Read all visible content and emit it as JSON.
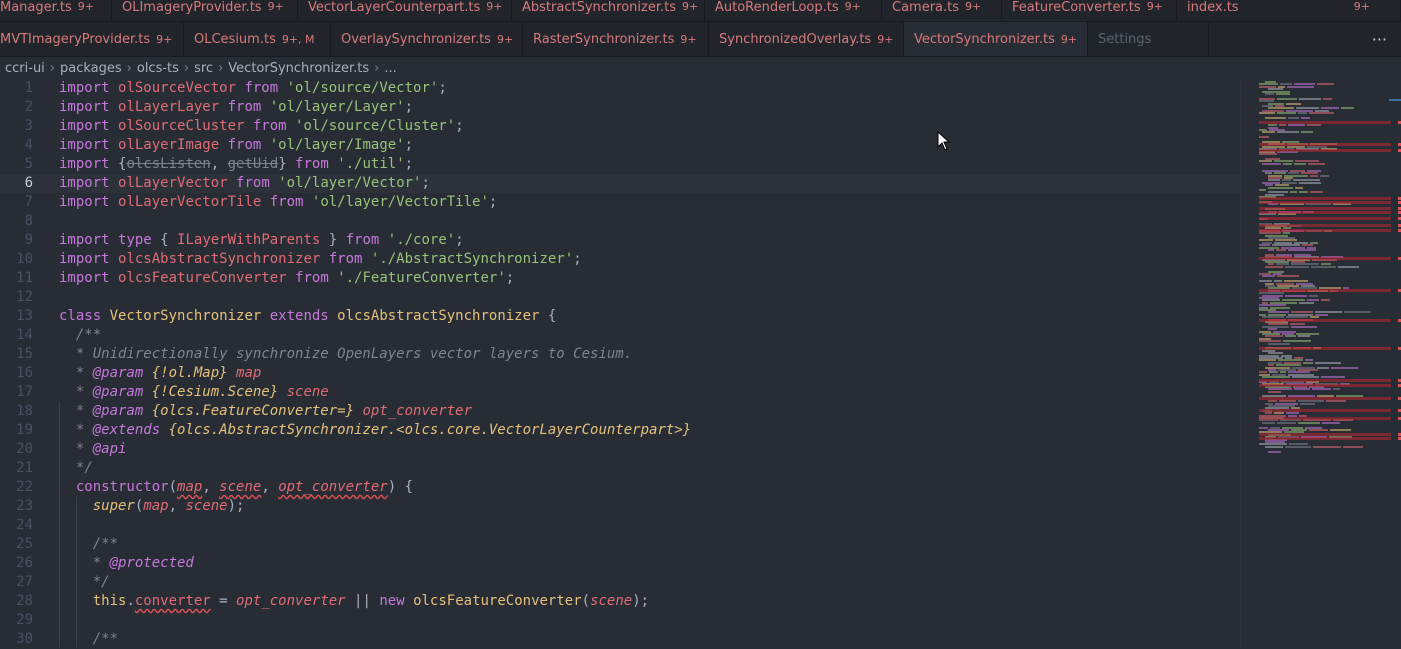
{
  "tabs_row1": [
    {
      "label": "Manager.ts",
      "badge": "9+"
    },
    {
      "label": "OLImageryProvider.ts",
      "badge": "9+"
    },
    {
      "label": "VectorLayerCounterpart.ts",
      "badge": "9+"
    },
    {
      "label": "AbstractSynchronizer.ts",
      "badge": "9+"
    },
    {
      "label": "AutoRenderLoop.ts",
      "badge": "9+"
    },
    {
      "label": "Camera.ts",
      "badge": "9+"
    },
    {
      "label": "FeatureConverter.ts",
      "badge": "9+"
    },
    {
      "label": "index.ts",
      "badge": "9+"
    }
  ],
  "tabs_row2": [
    {
      "label": "MVTImageryProvider.ts",
      "badge": "9+"
    },
    {
      "label": "OLCesium.ts",
      "badge": "9+, M"
    },
    {
      "label": "OverlaySynchronizer.ts",
      "badge": "9+"
    },
    {
      "label": "RasterSynchronizer.ts",
      "badge": "9+"
    },
    {
      "label": "SynchronizedOverlay.ts",
      "badge": "9+"
    },
    {
      "label": "VectorSynchronizer.ts",
      "badge": "9+",
      "active": true
    },
    {
      "label": "Settings",
      "badge": ""
    }
  ],
  "more_label": "···",
  "close_label": "✕",
  "breadcrumb": [
    "ccri-ui",
    "packages",
    "olcs-ts",
    "src",
    "VectorSynchronizer.ts",
    "..."
  ],
  "breadcrumb_sep": "›",
  "current_line": 6,
  "code": [
    [
      [
        "import ",
        "k"
      ],
      [
        "olSourceVector ",
        "v"
      ],
      [
        "from ",
        "k"
      ],
      [
        "'ol/source/Vector'",
        "s"
      ],
      [
        ";",
        "p"
      ]
    ],
    [
      [
        "import ",
        "k"
      ],
      [
        "olLayerLayer ",
        "v"
      ],
      [
        "from ",
        "k"
      ],
      [
        "'ol/layer/Layer'",
        "s"
      ],
      [
        ";",
        "p"
      ]
    ],
    [
      [
        "import ",
        "k"
      ],
      [
        "olSourceCluster ",
        "v"
      ],
      [
        "from ",
        "k"
      ],
      [
        "'ol/source/Cluster'",
        "s"
      ],
      [
        ";",
        "p"
      ]
    ],
    [
      [
        "import ",
        "k"
      ],
      [
        "olLayerImage ",
        "v"
      ],
      [
        "from ",
        "k"
      ],
      [
        "'ol/layer/Image'",
        "s"
      ],
      [
        ";",
        "p"
      ]
    ],
    [
      [
        "import ",
        "k"
      ],
      [
        "{",
        "p"
      ],
      [
        "olcsListen",
        "st"
      ],
      [
        ", ",
        "p"
      ],
      [
        "getUid",
        "st"
      ],
      [
        "} ",
        "p"
      ],
      [
        "from ",
        "k"
      ],
      [
        "'./util'",
        "s"
      ],
      [
        ";",
        "p"
      ]
    ],
    [
      [
        "import ",
        "k"
      ],
      [
        "olLayerVector ",
        "v"
      ],
      [
        "from ",
        "k"
      ],
      [
        "'ol/layer/Vector'",
        "s"
      ],
      [
        ";",
        "p"
      ]
    ],
    [
      [
        "import ",
        "k"
      ],
      [
        "olLayerVectorTile ",
        "v"
      ],
      [
        "from ",
        "k"
      ],
      [
        "'ol/layer/VectorTile'",
        "s"
      ],
      [
        ";",
        "p"
      ]
    ],
    [],
    [
      [
        "import ",
        "k"
      ],
      [
        "type ",
        "k"
      ],
      [
        "{ ",
        "p"
      ],
      [
        "ILayerWithParents ",
        "v"
      ],
      [
        "} ",
        "p"
      ],
      [
        "from ",
        "k"
      ],
      [
        "'./core'",
        "s"
      ],
      [
        ";",
        "p"
      ]
    ],
    [
      [
        "import ",
        "k"
      ],
      [
        "olcsAbstractSynchronizer ",
        "v"
      ],
      [
        "from ",
        "k"
      ],
      [
        "'./AbstractSynchronizer'",
        "s"
      ],
      [
        ";",
        "p"
      ]
    ],
    [
      [
        "import ",
        "k"
      ],
      [
        "olcsFeatureConverter ",
        "v"
      ],
      [
        "from ",
        "k"
      ],
      [
        "'./FeatureConverter'",
        "s"
      ],
      [
        ";",
        "p"
      ]
    ],
    [],
    [
      [
        "class ",
        "k"
      ],
      [
        "VectorSynchronizer ",
        "y"
      ],
      [
        "extends ",
        "k"
      ],
      [
        "olcsAbstractSynchronizer ",
        "y"
      ],
      [
        "{",
        "p"
      ]
    ],
    [
      [
        "  /**",
        "c"
      ]
    ],
    [
      [
        "  * Unidirectionally synchronize OpenLayers vector layers to Cesium.",
        "c"
      ]
    ],
    [
      [
        "  * ",
        "c"
      ],
      [
        "@param ",
        "ct"
      ],
      [
        "{!ol.Map} ",
        "cy"
      ],
      [
        "map",
        "cv"
      ]
    ],
    [
      [
        "  * ",
        "c"
      ],
      [
        "@param ",
        "ct"
      ],
      [
        "{!Cesium.Scene} ",
        "cy"
      ],
      [
        "scene",
        "cv"
      ]
    ],
    [
      [
        "  * ",
        "c"
      ],
      [
        "@param ",
        "ct"
      ],
      [
        "{olcs.FeatureConverter=} ",
        "cy"
      ],
      [
        "opt_converter",
        "cv"
      ]
    ],
    [
      [
        "  * ",
        "c"
      ],
      [
        "@extends ",
        "ct"
      ],
      [
        "{olcs.AbstractSynchronizer.<olcs.core.VectorLayerCounterpart>}",
        "cy"
      ]
    ],
    [
      [
        "  * ",
        "c"
      ],
      [
        "@api",
        "ct"
      ]
    ],
    [
      [
        "  */",
        "c"
      ]
    ],
    [
      [
        "  ",
        "p"
      ],
      [
        "constructor",
        "k"
      ],
      [
        "(",
        "p"
      ],
      [
        "map",
        "vi sq"
      ],
      [
        ", ",
        "p"
      ],
      [
        "scene",
        "vi sq"
      ],
      [
        ", ",
        "p"
      ],
      [
        "opt_converter",
        "vi sq"
      ],
      [
        ") {",
        "p"
      ]
    ],
    [
      [
        "    ",
        "p"
      ],
      [
        "super",
        "cy"
      ],
      [
        "(",
        "p"
      ],
      [
        "map",
        "vi"
      ],
      [
        ", ",
        "p"
      ],
      [
        "scene",
        "vi"
      ],
      [
        ");",
        "p"
      ]
    ],
    [],
    [
      [
        "    /**",
        "c"
      ]
    ],
    [
      [
        "    * ",
        "c"
      ],
      [
        "@protected",
        "ct"
      ]
    ],
    [
      [
        "    */",
        "c"
      ]
    ],
    [
      [
        "    this",
        "y"
      ],
      [
        ".",
        "p"
      ],
      [
        "converter",
        "v sq"
      ],
      [
        " = ",
        "p"
      ],
      [
        "opt_converter ",
        "vi"
      ],
      [
        "|| ",
        "p"
      ],
      [
        "new ",
        "k"
      ],
      [
        "olcsFeatureConverter",
        "y"
      ],
      [
        "(",
        "p"
      ],
      [
        "scene",
        "vi"
      ],
      [
        ");",
        "p"
      ]
    ],
    [],
    [
      [
        "    /**",
        "c"
      ]
    ]
  ],
  "colors": {
    "background": "#282c34",
    "tabbar": "#21252b",
    "error": "#e06c75",
    "keyword": "#c678dd",
    "string": "#98c379"
  },
  "icons": {
    "cursor": "mouse-pointer-icon"
  }
}
